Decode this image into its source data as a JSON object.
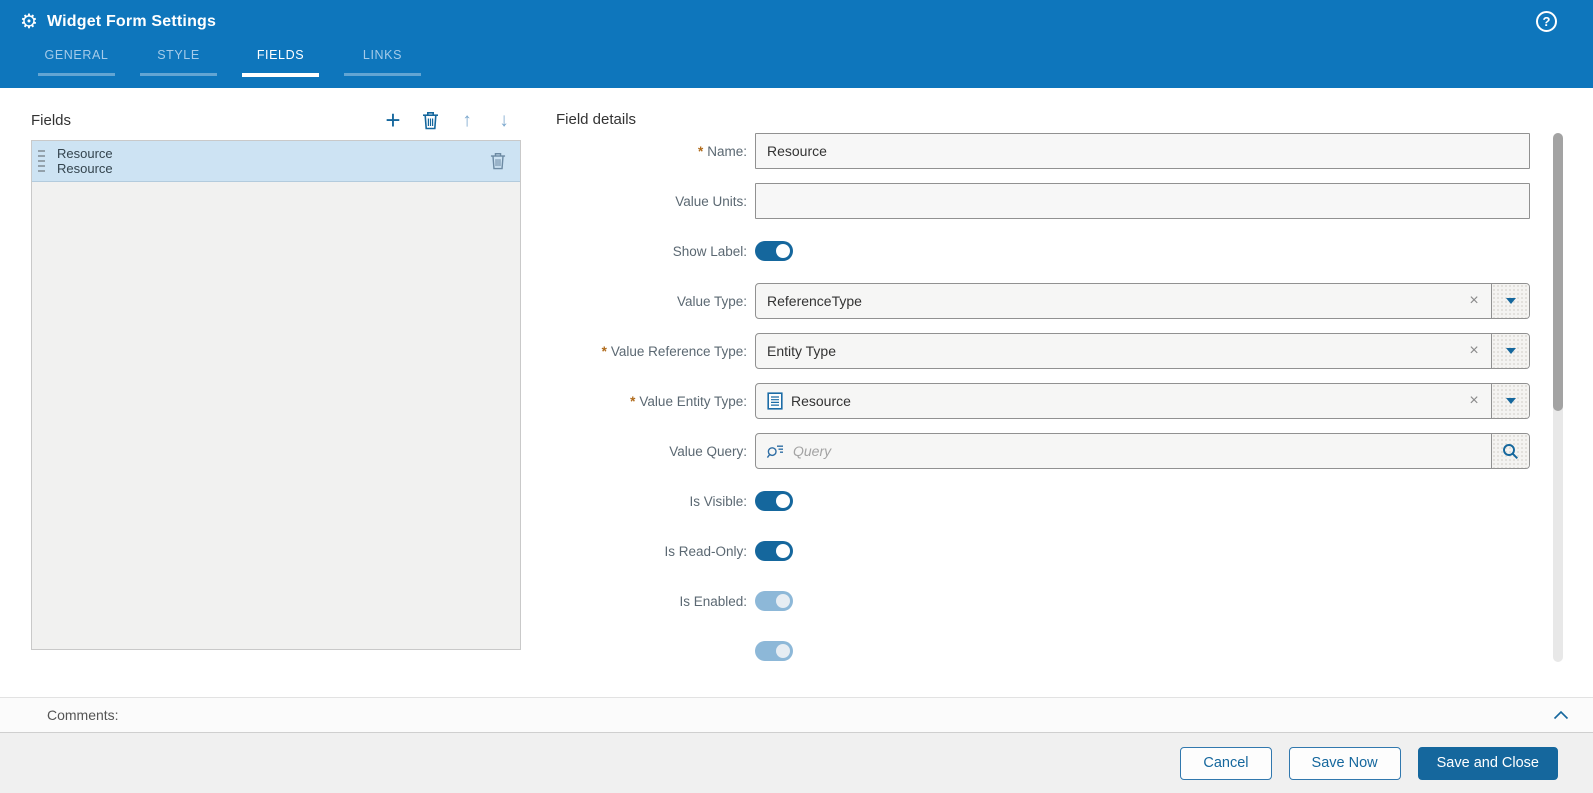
{
  "header": {
    "title": "Widget Form Settings",
    "help_glyph": "?",
    "tabs": [
      {
        "label": "GENERAL",
        "active": false
      },
      {
        "label": "STYLE",
        "active": false
      },
      {
        "label": "FIELDS",
        "active": true
      },
      {
        "label": "LINKS",
        "active": false
      }
    ]
  },
  "fields_panel": {
    "title": "Fields",
    "toolbar": {
      "add_glyph": "+",
      "move_up_glyph": "↑",
      "move_down_glyph": "↓"
    },
    "items": [
      {
        "lines": [
          "Resource",
          "Resource"
        ],
        "selected": true
      }
    ]
  },
  "details": {
    "title": "Field details",
    "required_marker": "*",
    "clear_glyph": "×",
    "rows": [
      {
        "label": "Name:",
        "required": true,
        "type": "text",
        "value": "Resource"
      },
      {
        "label": "Value Units:",
        "required": false,
        "type": "text",
        "value": ""
      },
      {
        "label": "Show Label:",
        "type": "toggle",
        "on": true,
        "disabled": false
      },
      {
        "label": "Value Type:",
        "required": false,
        "type": "dropdown",
        "value": "ReferenceType"
      },
      {
        "label": "Value Reference Type:",
        "required": true,
        "type": "dropdown",
        "value": "Entity Type"
      },
      {
        "label": "Value Entity Type:",
        "required": true,
        "type": "dropdown",
        "value": "Resource",
        "icon": "entity-type-icon"
      },
      {
        "label": "Value Query:",
        "type": "query",
        "placeholder": "Query"
      },
      {
        "label": "Is Visible:",
        "type": "toggle",
        "on": true,
        "disabled": false
      },
      {
        "label": "Is Read-Only:",
        "type": "toggle",
        "on": true,
        "disabled": false
      },
      {
        "label": "Is Enabled:",
        "type": "toggle",
        "on": true,
        "disabled": true
      }
    ]
  },
  "comments": {
    "label": "Comments:"
  },
  "footer": {
    "buttons": [
      {
        "label": "Cancel",
        "primary": false
      },
      {
        "label": "Save Now",
        "primary": false
      },
      {
        "label": "Save and Close",
        "primary": true
      }
    ]
  },
  "colors": {
    "header_blue": "#0e76bc",
    "accent_blue": "#15679d",
    "disabled_toggle_blue": "#8db8d8",
    "selected_item_bg": "#cde3f3",
    "required_asterisk": "#b06a1a",
    "input_border": "#919191"
  }
}
